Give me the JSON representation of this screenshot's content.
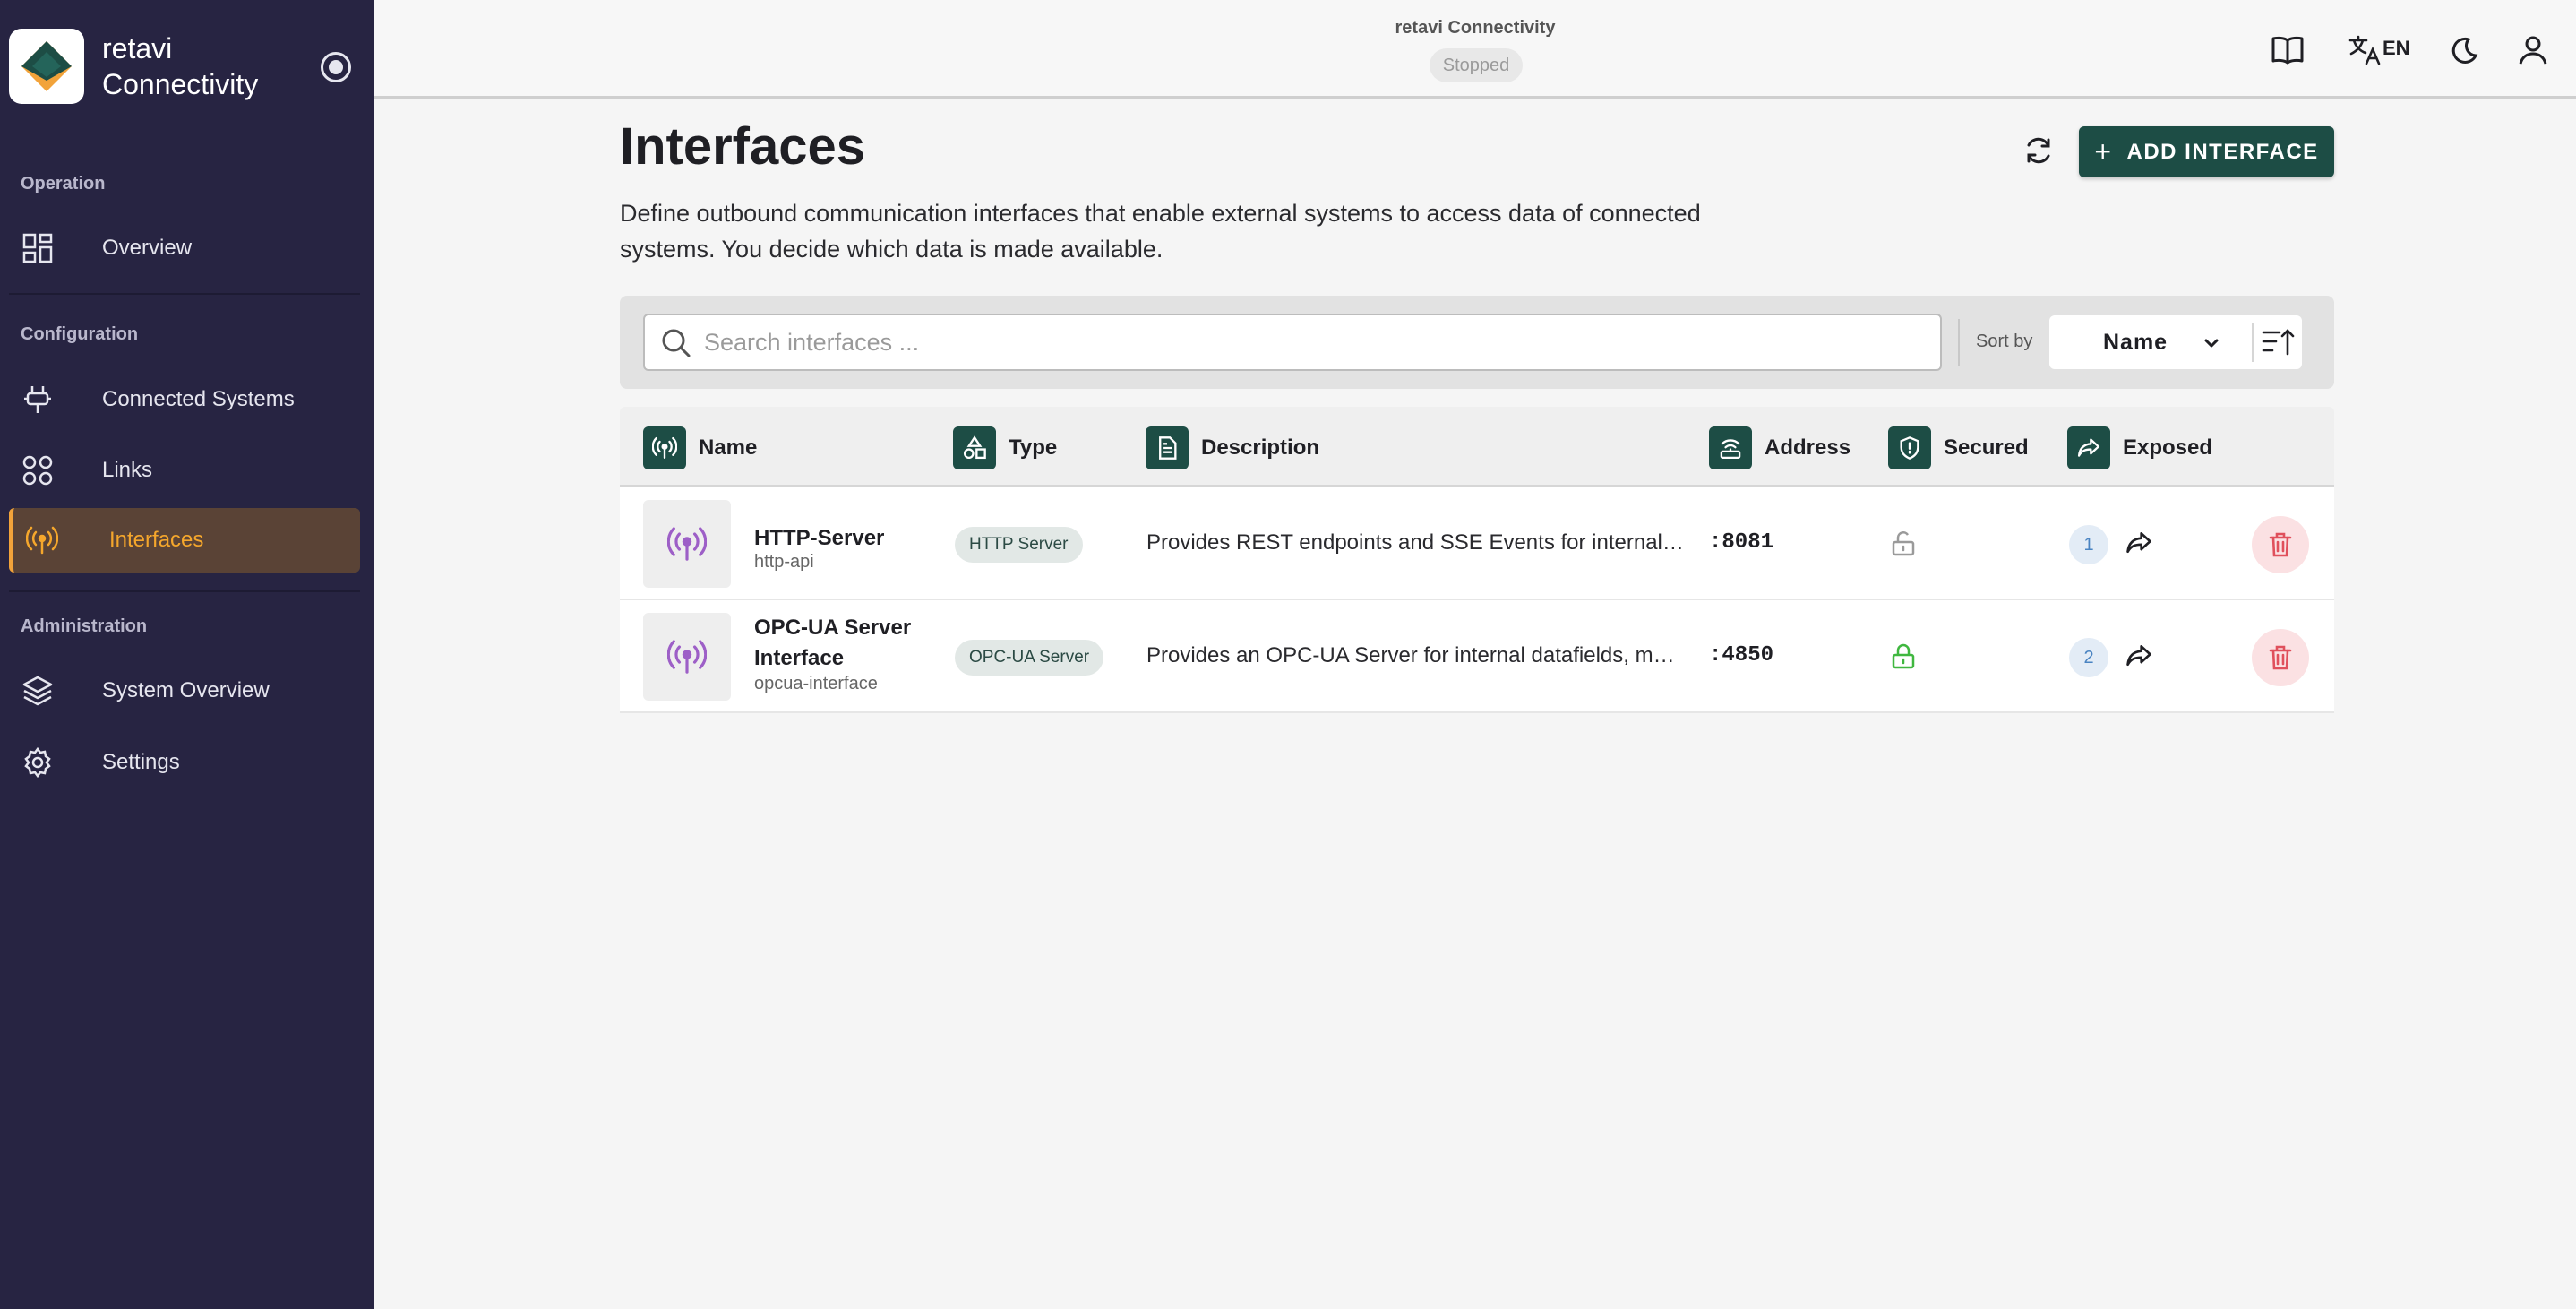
{
  "app": {
    "title_line1": "retavi",
    "title_line2": "Connectivity",
    "header_name": "retavi Connectivity",
    "status": "Stopped",
    "language": "EN"
  },
  "sidebar": {
    "sections": [
      {
        "label": "Operation",
        "items": [
          {
            "label": "Overview",
            "icon": "dashboard-icon"
          }
        ]
      },
      {
        "label": "Configuration",
        "items": [
          {
            "label": "Connected Systems",
            "icon": "plug-icon"
          },
          {
            "label": "Links",
            "icon": "links-icon"
          },
          {
            "label": "Interfaces",
            "icon": "antenna-icon",
            "active": true
          }
        ]
      },
      {
        "label": "Administration",
        "items": [
          {
            "label": "System Overview",
            "icon": "layers-icon"
          },
          {
            "label": "Settings",
            "icon": "gear-icon"
          }
        ]
      }
    ]
  },
  "page": {
    "title": "Interfaces",
    "description": "Define outbound communication interfaces that enable external systems to access data of connected systems. You decide which data is made available.",
    "add_button": "ADD INTERFACE"
  },
  "filter": {
    "search_placeholder": "Search interfaces ...",
    "sort_label": "Sort by",
    "sort_value": "Name"
  },
  "table": {
    "columns": [
      "Name",
      "Type",
      "Description",
      "Address",
      "Secured",
      "Exposed"
    ],
    "rows": [
      {
        "name": "HTTP-Server",
        "id": "http-api",
        "type": "HTTP Server",
        "description": "Provides REST endpoints and SSE Events for internal datafields",
        "address": ":8081",
        "secured": false,
        "exposed": "1"
      },
      {
        "name_line1": "OPC-UA Server",
        "name_line2": "Interface",
        "id": "opcua-interface",
        "type": "OPC-UA Server",
        "description": "Provides an OPC-UA Server for internal datafields, metadata",
        "address": ":4850",
        "secured": true,
        "exposed": "2"
      }
    ]
  },
  "colors": {
    "sidebar_bg": "#272442",
    "accent": "#1d4d45",
    "active_nav": "#f5a72c",
    "secured_green": "#3fb73f",
    "delete_red": "#e0505c",
    "interface_icon": "#9d5fc7"
  }
}
